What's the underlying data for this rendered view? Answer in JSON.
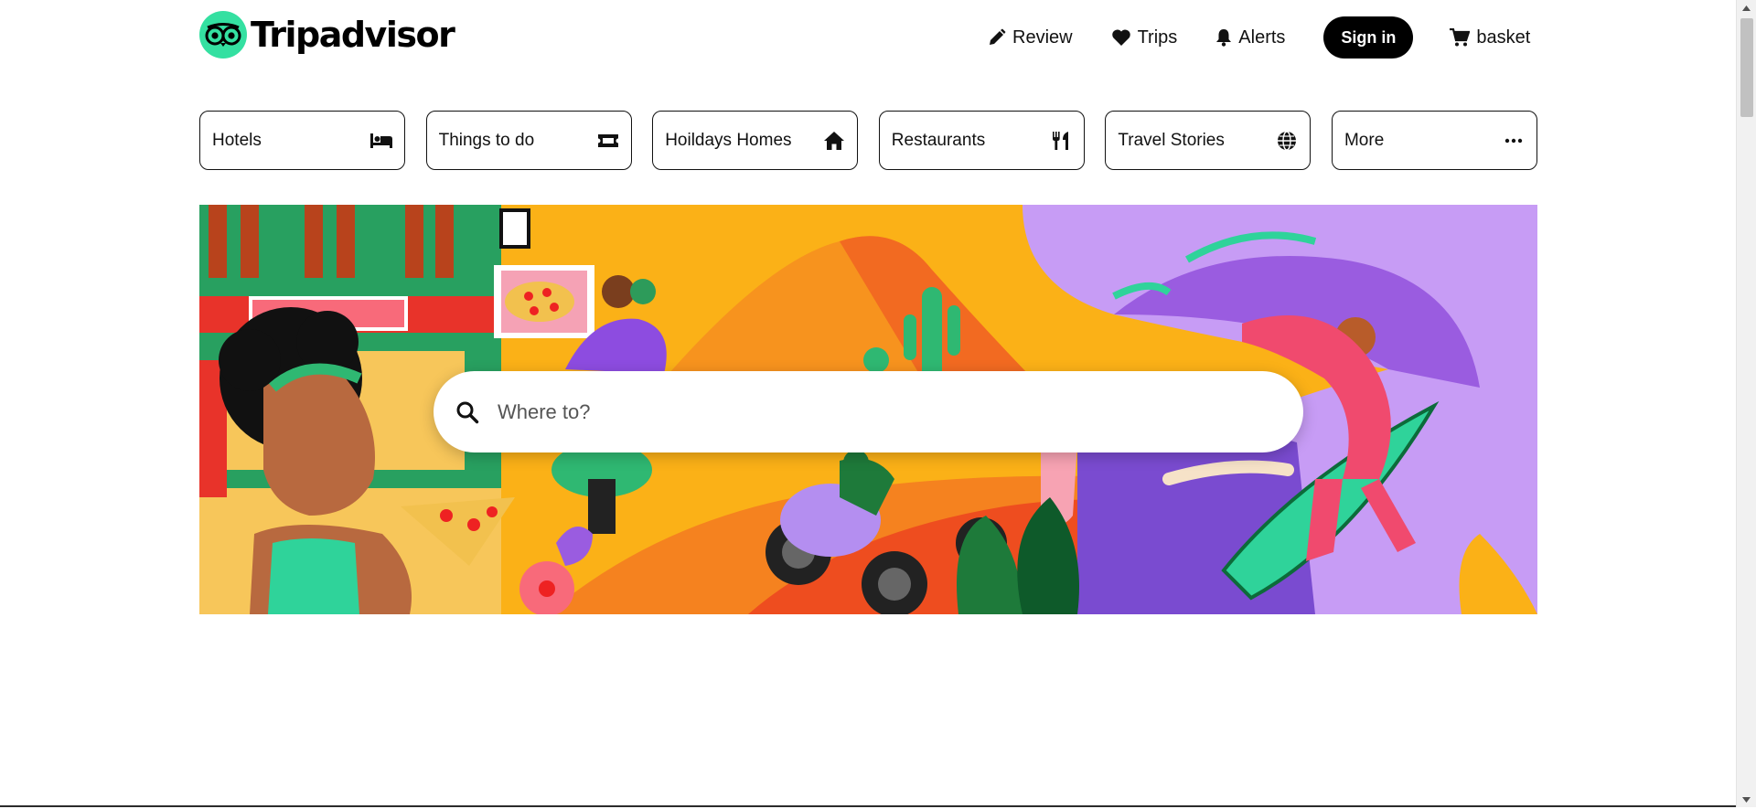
{
  "brand": {
    "name": "Tripadvisor",
    "accent": "#34e0a1"
  },
  "topnav": {
    "review": {
      "label": "Review",
      "icon": "pencil-icon"
    },
    "trips": {
      "label": "Trips",
      "icon": "heart-icon"
    },
    "alerts": {
      "label": "Alerts",
      "icon": "bell-icon"
    },
    "signin": {
      "label": "Sign in"
    },
    "basket": {
      "label": "basket",
      "icon": "cart-icon"
    }
  },
  "tabs": [
    {
      "label": "Hotels",
      "icon": "bed-icon"
    },
    {
      "label": "Things to do",
      "icon": "ticket-icon"
    },
    {
      "label": "Hoildays Homes",
      "icon": "home-icon"
    },
    {
      "label": "Restaurants",
      "icon": "fork-knife-icon"
    },
    {
      "label": "Travel Stories",
      "icon": "globe-icon"
    },
    {
      "label": "More",
      "icon": "ellipsis-icon"
    }
  ],
  "search": {
    "placeholder": "Where to?",
    "value": ""
  }
}
